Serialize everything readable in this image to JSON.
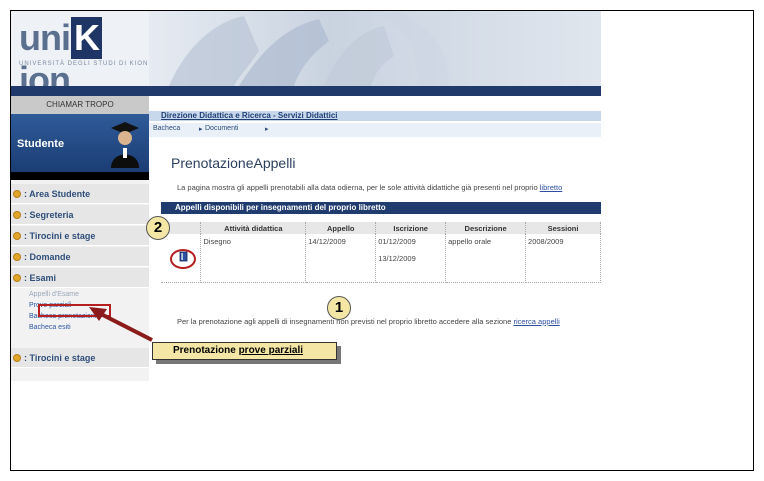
{
  "logo": {
    "pre": "uni",
    "k": "K",
    "post": "ion",
    "subtitle": "UNIVERSITÀ DEGLI STUDI DI KION"
  },
  "sidebar": {
    "top_label": "CHIAMAR TROPO",
    "student_label": "Studente",
    "menu": [
      {
        "label": ": Area Studente"
      },
      {
        "label": ": Segreteria"
      },
      {
        "label": ": Tirocini e stage"
      },
      {
        "label": ": Domande"
      },
      {
        "label": ": Esami"
      }
    ],
    "sub_items": [
      {
        "label": "Appelli d'Esame"
      },
      {
        "label": "Prove parziali"
      },
      {
        "label": "Bacheca prenotazioni"
      },
      {
        "label": "Bacheca esiti"
      }
    ],
    "last_menu": {
      "label": ": Tirocini e stage"
    }
  },
  "breadcrumb": {
    "title": "Direzione Didattica e Ricerca - Servizi Didattici"
  },
  "tabs": {
    "bacheca": "Bacheca",
    "documenti": "Documenti"
  },
  "page": {
    "heading": "PrenotazioneAppelli",
    "desc_prefix": "La pagina mostra gli appelli prenotabili alla data odierna, per le sole attività didattiche già presenti nel proprio",
    "desc_link": "libretto",
    "section_title": "Appelli disponibili per insegnamenti del proprio libretto",
    "footer_prefix": "Per la prenotazione agli appelli di insegnamenti non previsti nel proprio libretto accedere alla sezione",
    "footer_link": "ricerca appelli"
  },
  "table": {
    "headers": [
      "Attività didattica",
      "Appello",
      "Iscrizione",
      "Descrizione",
      "Sessioni"
    ],
    "row": {
      "attivita": "Disegno",
      "appello": "14/12/2009",
      "iscrizione_1": "01/12/2009",
      "iscrizione_2": "13/12/2009",
      "descrizione": "appello orale",
      "sessioni": "2008/2009"
    }
  },
  "annotations": {
    "badge_1": "1",
    "badge_2": "2",
    "callout_prefix": "Prenotazione",
    "callout_link": "prove parziali"
  },
  "colors": {
    "nav": "#1f3a6b",
    "accent_red": "#b51f1f",
    "callout_bg": "#f4e7a6",
    "bullet": "#e0a52a"
  }
}
